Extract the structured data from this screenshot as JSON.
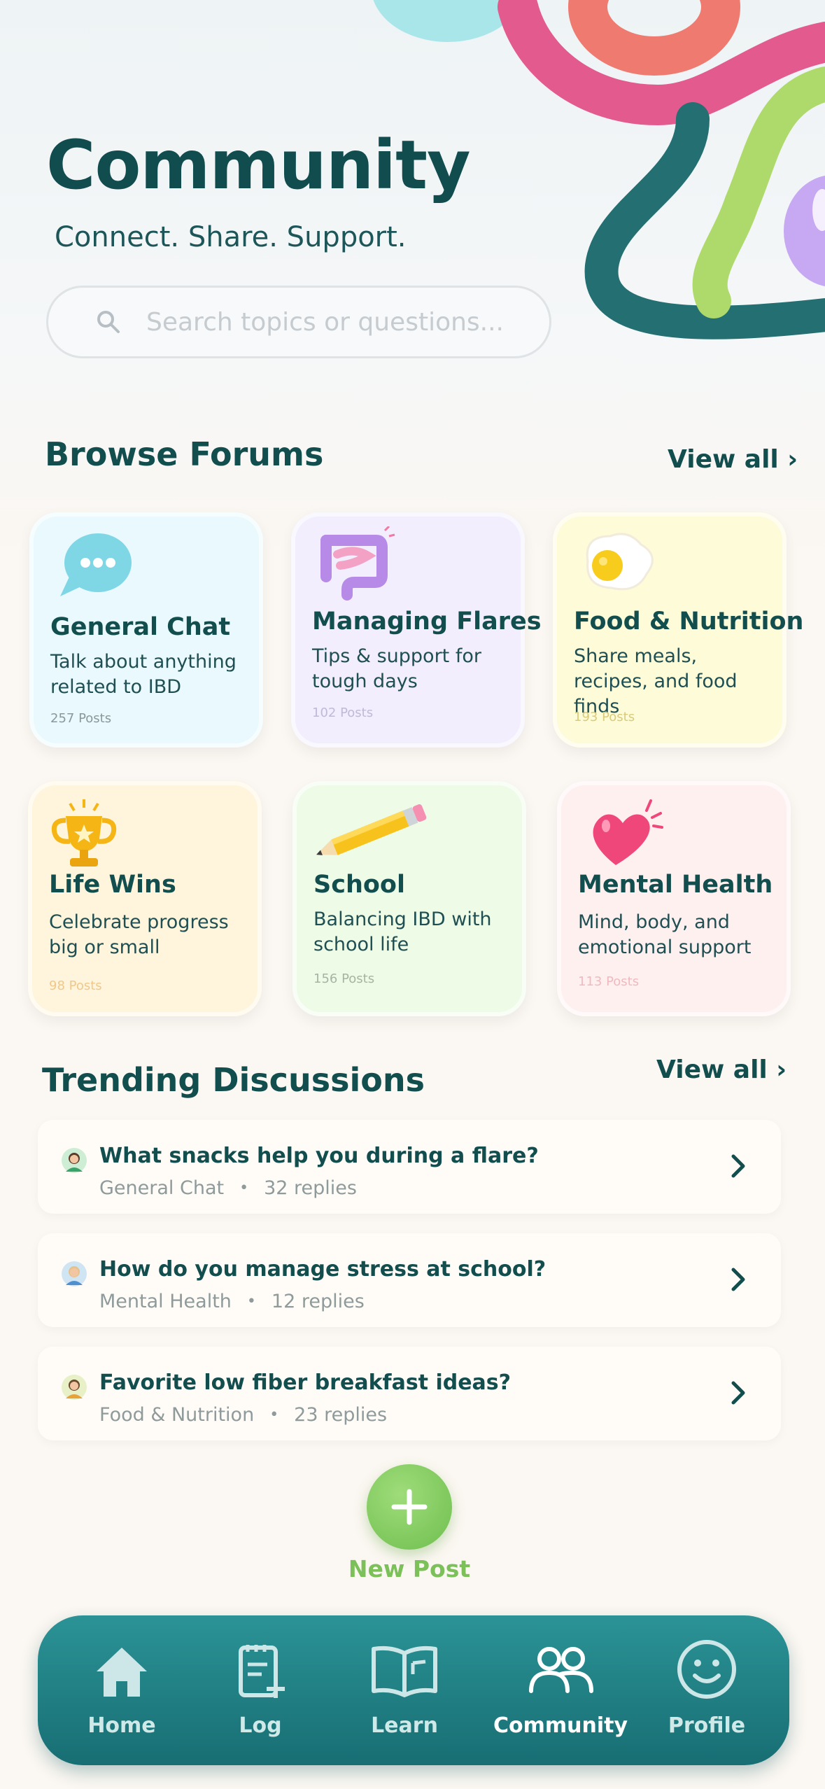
{
  "header": {
    "title": "Community",
    "subtitle": "Connect. Share. Support."
  },
  "search": {
    "placeholder": "Search topics or questions..."
  },
  "forums_section": {
    "title": "Browse Forums",
    "view_all": "View all ›",
    "cards": [
      {
        "title": "General Chat",
        "desc": "Talk about anything related to IBD",
        "count": "257 Posts",
        "bg": "#e9f9fd",
        "count_color": "#8b9899",
        "icon": "speech-bubble-icon"
      },
      {
        "title": "Managing Flares",
        "desc": "Tips & support for tough days",
        "count": "102 Posts",
        "bg": "#f2eefe",
        "count_color": "#c2b8d8",
        "icon": "intestine-icon"
      },
      {
        "title": "Food & Nutrition",
        "desc": "Share meals, recipes, and food finds",
        "count": "193 Posts",
        "bg": "#fdfbd8",
        "count_color": "#dacb7a",
        "icon": "fried-egg-icon"
      },
      {
        "title": "Life Wins",
        "desc": "Celebrate progress big or small",
        "count": "98 Posts",
        "bg": "#fff4dc",
        "count_color": "#f1c88a",
        "icon": "trophy-icon"
      },
      {
        "title": "School",
        "desc": "Balancing IBD with school life",
        "count": "156 Posts",
        "bg": "#eefbe6",
        "count_color": "#a6b5a3",
        "icon": "pencil-icon"
      },
      {
        "title": "Mental Health",
        "desc": "Mind, body, and emotional support",
        "count": "113 Posts",
        "bg": "#fff0f0",
        "count_color": "#f0b9bf",
        "icon": "heart-icon"
      }
    ]
  },
  "trending_section": {
    "title": "Trending Discussions",
    "view_all": "View all ›",
    "items": [
      {
        "question": "What snacks help you during a flare?",
        "forum": "General Chat",
        "replies": "32 replies",
        "avatar_bg": "#cdeed5"
      },
      {
        "question": "How do you manage stress at school?",
        "forum": "Mental Health",
        "replies": "12 replies",
        "avatar_bg": "#cfe5f3"
      },
      {
        "question": "Favorite low fiber breakfast ideas?",
        "forum": "Food & Nutrition",
        "replies": "23 replies",
        "avatar_bg": "#e8f0c8"
      }
    ]
  },
  "new_post": {
    "label": "New Post"
  },
  "nav": {
    "items": [
      {
        "label": "Home",
        "icon": "home-icon"
      },
      {
        "label": "Log",
        "icon": "log-icon"
      },
      {
        "label": "Learn",
        "icon": "book-icon"
      },
      {
        "label": "Community",
        "icon": "community-icon",
        "active": true
      },
      {
        "label": "Profile",
        "icon": "smiley-icon"
      }
    ]
  },
  "colors": {
    "primary": "#134e4e",
    "accent_green": "#7cc05a",
    "nav_teal": "#1f8085"
  }
}
